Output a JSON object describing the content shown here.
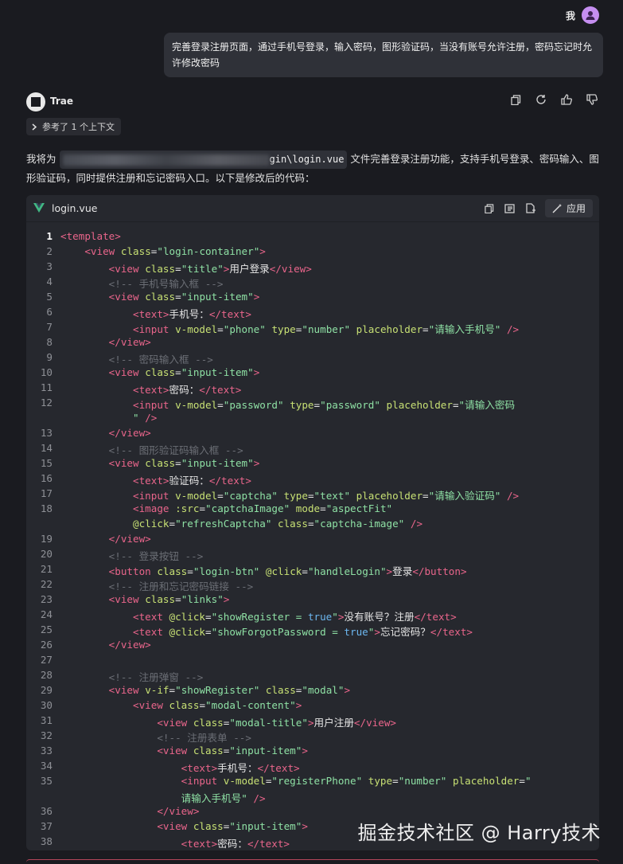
{
  "user": {
    "name": "我",
    "message": "完善登录注册页面，通过手机号登录，输入密码，图形验证码，当没有账号允许注册，密码忘记时允许修改密码"
  },
  "agent": {
    "name": "Trae",
    "context_chip": "参考了 1 个上下文",
    "actions": [
      "copy-icon",
      "regenerate-icon",
      "thumbs-up-icon",
      "thumbs-down-icon"
    ]
  },
  "reply": {
    "prefix": "我将为",
    "file": "gin\\login.vue",
    "text": "文件完善登录注册功能，支持手机号登录、密码输入、图形验证码，同时提供注册和忘记密码入口。以下是修改后的代码："
  },
  "code_block": {
    "filename": "login.vue",
    "apply_label": "应用",
    "tools": [
      "copy-icon",
      "insert-icon",
      "new-file-icon"
    ]
  },
  "code_lines": [
    {
      "n": "1",
      "html": "<span class=\"t\">&lt;template&gt;</span>"
    },
    {
      "n": "2",
      "html": "    <span class=\"t\">&lt;view</span> <span class=\"a\">class</span>=<span class=\"s\">\"login-container\"</span><span class=\"t\">&gt;</span>"
    },
    {
      "n": "3",
      "html": "        <span class=\"t\">&lt;view</span> <span class=\"a\">class</span>=<span class=\"s\">\"title\"</span><span class=\"t\">&gt;</span>用户登录<span class=\"t\">&lt;/view&gt;</span>"
    },
    {
      "n": "4",
      "html": "        <span class=\"c\">&lt;!-- 手机号输入框 --&gt;</span>"
    },
    {
      "n": "5",
      "html": "        <span class=\"t\">&lt;view</span> <span class=\"a\">class</span>=<span class=\"s\">\"input-item\"</span><span class=\"t\">&gt;</span>"
    },
    {
      "n": "6",
      "html": "            <span class=\"t\">&lt;text&gt;</span>手机号：<span class=\"t\">&lt;/text&gt;</span>"
    },
    {
      "n": "7",
      "html": "            <span class=\"t\">&lt;input</span> <span class=\"a\">v-model</span>=<span class=\"s\">\"phone\"</span> <span class=\"a\">type</span>=<span class=\"s\">\"number\"</span> <span class=\"a\">placeholder</span>=<span class=\"s\">\"请输入手机号\"</span> <span class=\"t\">/&gt;</span>"
    },
    {
      "n": "8",
      "html": "        <span class=\"t\">&lt;/view&gt;</span>"
    },
    {
      "n": "9",
      "html": "        <span class=\"c\">&lt;!-- 密码输入框 --&gt;</span>"
    },
    {
      "n": "10",
      "html": "        <span class=\"t\">&lt;view</span> <span class=\"a\">class</span>=<span class=\"s\">\"input-item\"</span><span class=\"t\">&gt;</span>"
    },
    {
      "n": "11",
      "html": "            <span class=\"t\">&lt;text&gt;</span>密码：<span class=\"t\">&lt;/text&gt;</span>"
    },
    {
      "n": "12",
      "html": "            <span class=\"t\">&lt;input</span> <span class=\"a\">v-model</span>=<span class=\"s\">\"password\"</span> <span class=\"a\">type</span>=<span class=\"s\">\"password\"</span> <span class=\"a\">placeholder</span>=<span class=\"s\">\"请输入密码</span>"
    },
    {
      "n": "",
      "html": "            <span class=\"s\">\"</span> <span class=\"t\">/&gt;</span>"
    },
    {
      "n": "13",
      "html": "        <span class=\"t\">&lt;/view&gt;</span>"
    },
    {
      "n": "14",
      "html": "        <span class=\"c\">&lt;!-- 图形验证码输入框 --&gt;</span>"
    },
    {
      "n": "15",
      "html": "        <span class=\"t\">&lt;view</span> <span class=\"a\">class</span>=<span class=\"s\">\"input-item\"</span><span class=\"t\">&gt;</span>"
    },
    {
      "n": "16",
      "html": "            <span class=\"t\">&lt;text&gt;</span>验证码：<span class=\"t\">&lt;/text&gt;</span>"
    },
    {
      "n": "17",
      "html": "            <span class=\"t\">&lt;input</span> <span class=\"a\">v-model</span>=<span class=\"s\">\"captcha\"</span> <span class=\"a\">type</span>=<span class=\"s\">\"text\"</span> <span class=\"a\">placeholder</span>=<span class=\"s\">\"请输入验证码\"</span> <span class=\"t\">/&gt;</span>"
    },
    {
      "n": "18",
      "html": "            <span class=\"t\">&lt;image</span> <span class=\"a\">:src</span>=<span class=\"s\">\"captchaImage\"</span> <span class=\"a\">mode</span>=<span class=\"s\">\"aspectFit\"</span>"
    },
    {
      "n": "",
      "html": "            <span class=\"a\">@click</span>=<span class=\"s\">\"refreshCaptcha\"</span> <span class=\"a\">class</span>=<span class=\"s\">\"captcha-image\"</span> <span class=\"t\">/&gt;</span>"
    },
    {
      "n": "19",
      "html": "        <span class=\"t\">&lt;/view&gt;</span>"
    },
    {
      "n": "20",
      "html": "        <span class=\"c\">&lt;!-- 登录按钮 --&gt;</span>"
    },
    {
      "n": "21",
      "html": "        <span class=\"t\">&lt;button</span> <span class=\"a\">class</span>=<span class=\"s\">\"login-btn\"</span> <span class=\"a\">@click</span>=<span class=\"s\">\"handleLogin\"</span><span class=\"t\">&gt;</span>登录<span class=\"t\">&lt;/button&gt;</span>"
    },
    {
      "n": "22",
      "html": "        <span class=\"c\">&lt;!-- 注册和忘记密码链接 --&gt;</span>"
    },
    {
      "n": "23",
      "html": "        <span class=\"t\">&lt;view</span> <span class=\"a\">class</span>=<span class=\"s\">\"links\"</span><span class=\"t\">&gt;</span>"
    },
    {
      "n": "24",
      "html": "            <span class=\"t\">&lt;text</span> <span class=\"a\">@click</span>=<span class=\"s\">\"showRegister = </span><span class=\"k\">true</span><span class=\"s\">\"</span><span class=\"t\">&gt;</span>没有账号？注册<span class=\"t\">&lt;/text&gt;</span>"
    },
    {
      "n": "25",
      "html": "            <span class=\"t\">&lt;text</span> <span class=\"a\">@click</span>=<span class=\"s\">\"showForgotPassword = </span><span class=\"k\">true</span><span class=\"s\">\"</span><span class=\"t\">&gt;</span>忘记密码？<span class=\"t\">&lt;/text&gt;</span>"
    },
    {
      "n": "26",
      "html": "        <span class=\"t\">&lt;/view&gt;</span>"
    },
    {
      "n": "27",
      "html": ""
    },
    {
      "n": "28",
      "html": "        <span class=\"c\">&lt;!-- 注册弹窗 --&gt;</span>"
    },
    {
      "n": "29",
      "html": "        <span class=\"t\">&lt;view</span> <span class=\"a\">v-if</span>=<span class=\"s\">\"showRegister\"</span> <span class=\"a\">class</span>=<span class=\"s\">\"modal\"</span><span class=\"t\">&gt;</span>"
    },
    {
      "n": "30",
      "html": "            <span class=\"t\">&lt;view</span> <span class=\"a\">class</span>=<span class=\"s\">\"modal-content\"</span><span class=\"t\">&gt;</span>"
    },
    {
      "n": "31",
      "html": "                <span class=\"t\">&lt;view</span> <span class=\"a\">class</span>=<span class=\"s\">\"modal-title\"</span><span class=\"t\">&gt;</span>用户注册<span class=\"t\">&lt;/view&gt;</span>"
    },
    {
      "n": "32",
      "html": "                <span class=\"c\">&lt;!-- 注册表单 --&gt;</span>"
    },
    {
      "n": "33",
      "html": "                <span class=\"t\">&lt;view</span> <span class=\"a\">class</span>=<span class=\"s\">\"input-item\"</span><span class=\"t\">&gt;</span>"
    },
    {
      "n": "34",
      "html": "                    <span class=\"t\">&lt;text&gt;</span>手机号：<span class=\"t\">&lt;/text&gt;</span>"
    },
    {
      "n": "35",
      "html": "                    <span class=\"t\">&lt;input</span> <span class=\"a\">v-model</span>=<span class=\"s\">\"registerPhone\"</span> <span class=\"a\">type</span>=<span class=\"s\">\"number\"</span> <span class=\"a\">placeholder</span>=<span class=\"s\">\"</span>"
    },
    {
      "n": "",
      "html": "                    <span class=\"s\">请输入手机号\"</span> <span class=\"t\">/&gt;</span>"
    },
    {
      "n": "36",
      "html": "                <span class=\"t\">&lt;/view&gt;</span>"
    },
    {
      "n": "37",
      "html": "                <span class=\"t\">&lt;view</span> <span class=\"a\">class</span>=<span class=\"s\">\"input-item\"</span><span class=\"t\">&gt;</span>"
    },
    {
      "n": "38",
      "html": "                    <span class=\"t\">&lt;text&gt;</span>密码：<span class=\"t\">&lt;/text&gt;</span>"
    }
  ],
  "watermark": "掘金技术社区 @ Harry技术"
}
